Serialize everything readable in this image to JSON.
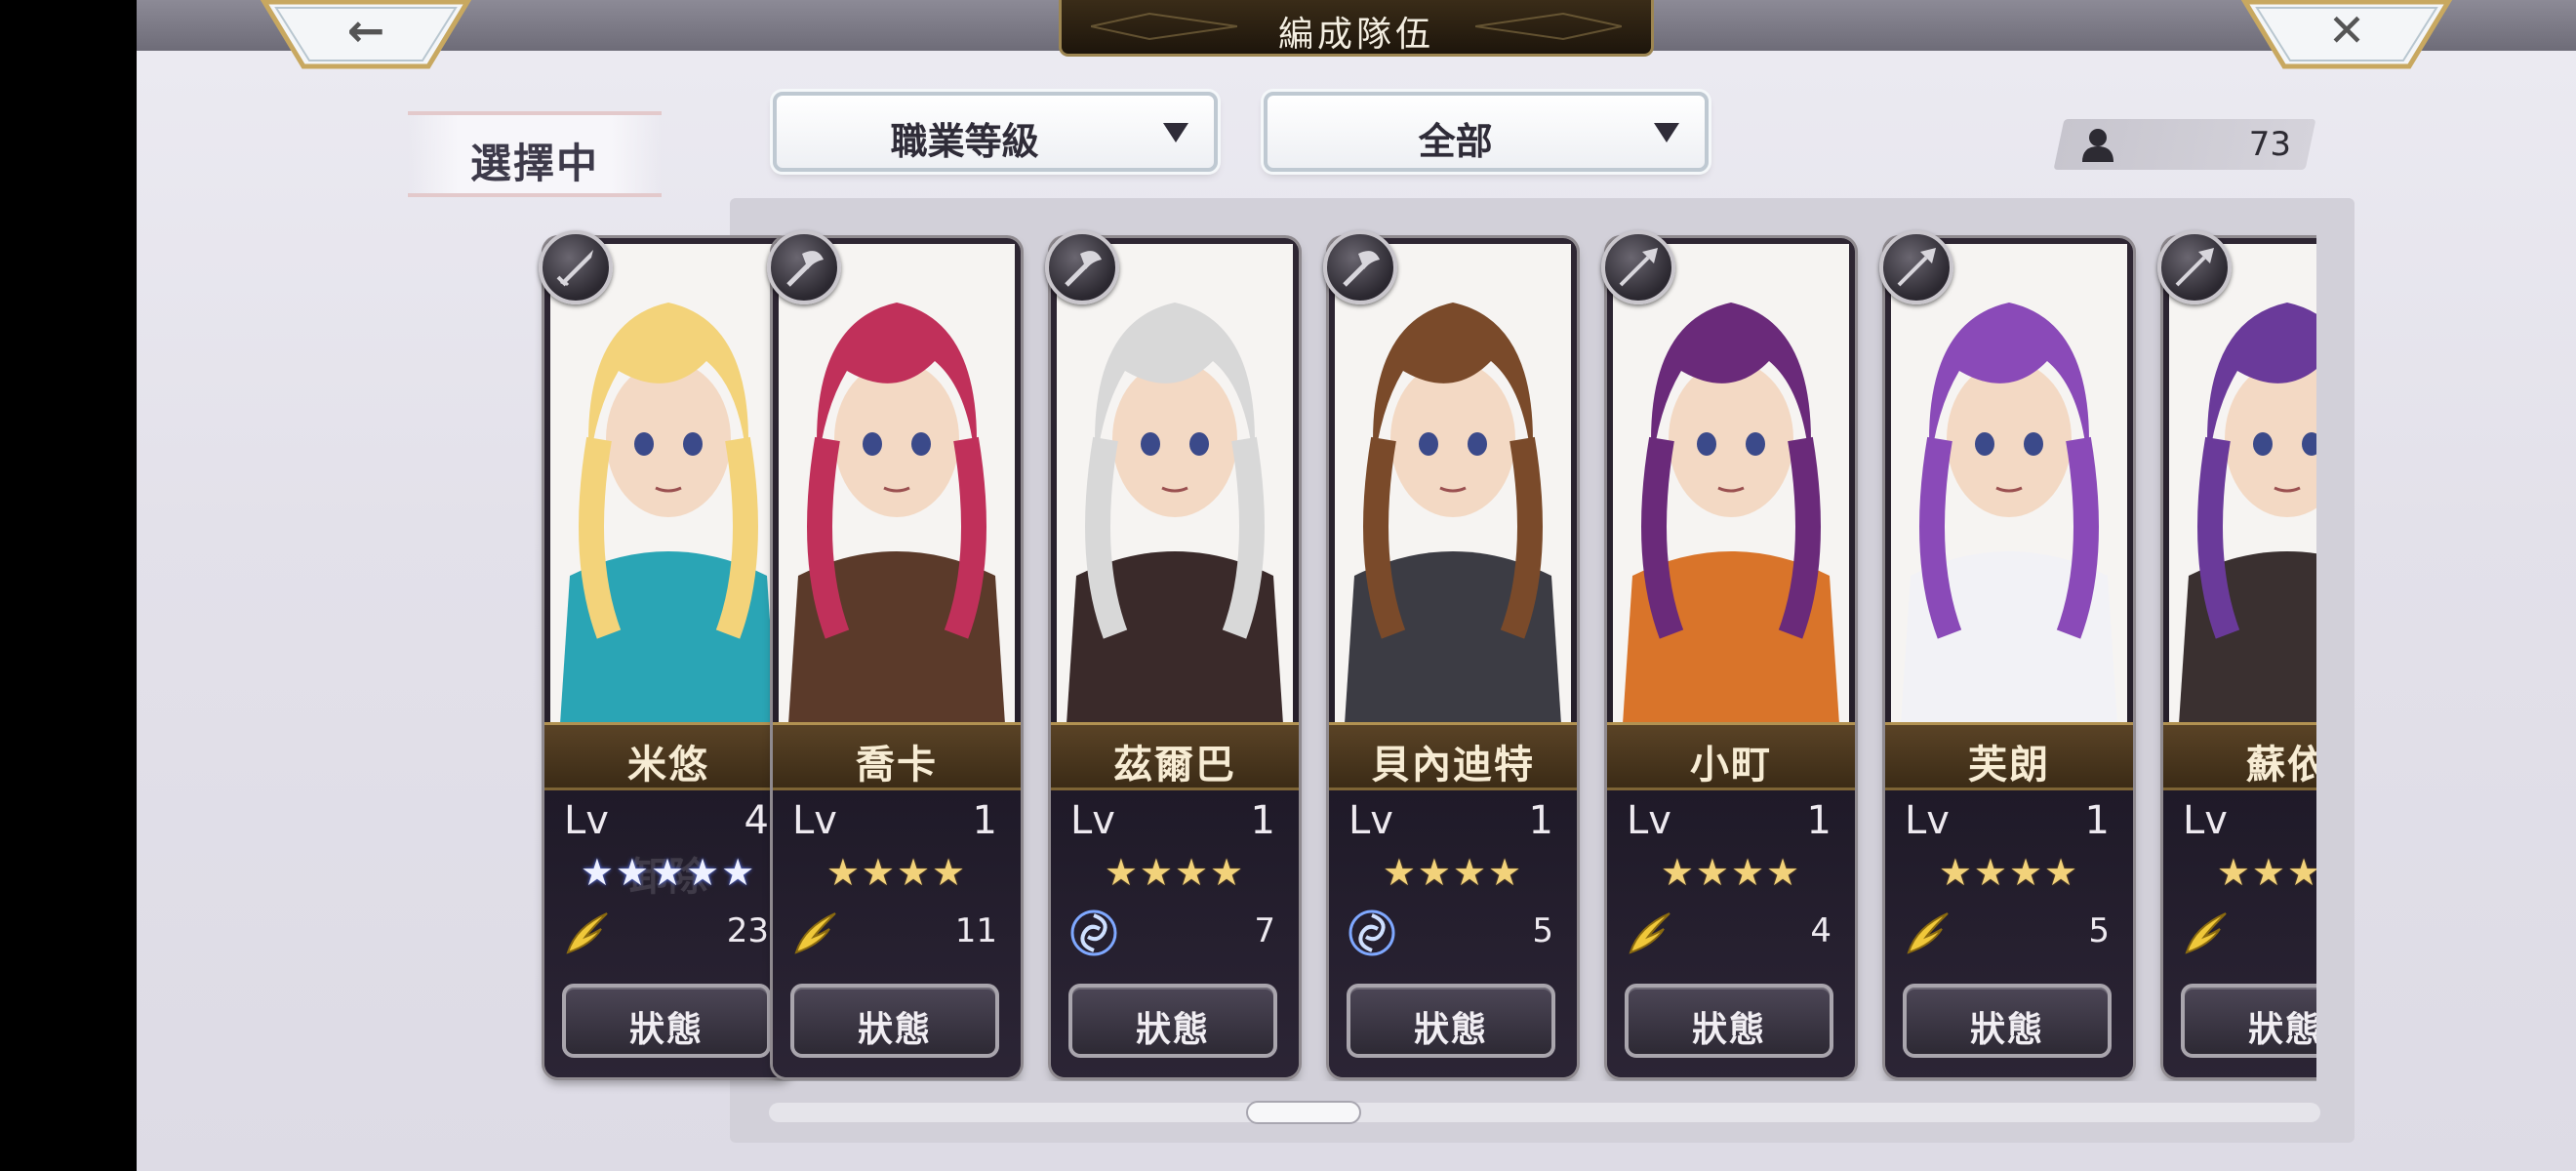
{
  "header": {
    "title": "編成隊伍",
    "back_glyph": "←",
    "close_glyph": "✕"
  },
  "selecting": {
    "label": "選擇中",
    "card": {
      "name": "米悠",
      "lv_label": "Lv",
      "level": "4",
      "stars": "★★★★★",
      "power": "23",
      "remove_label": "卸除",
      "status_label": "狀態",
      "class_icon": "sword-icon",
      "element_icon": "wind-icon",
      "hair_color": "#f3d37a",
      "outfit_color": "#2aa5b5"
    }
  },
  "filters": {
    "job_level": "職業等級",
    "scope": "全部"
  },
  "roster_count": "73",
  "roster": [
    {
      "name": "喬卡",
      "lv_label": "Lv",
      "level": "1",
      "stars": "★★★★",
      "power": "11",
      "status_label": "狀態",
      "class_icon": "axe-icon",
      "element_icon": "wind-icon",
      "hair_color": "#c0305a",
      "outfit_color": "#5b3a2a"
    },
    {
      "name": "茲爾巴",
      "lv_label": "Lv",
      "level": "1",
      "stars": "★★★★",
      "power": "7",
      "status_label": "狀態",
      "class_icon": "axe-icon",
      "element_icon": "vortex-icon",
      "hair_color": "#d8d8d8",
      "outfit_color": "#3a2a2a"
    },
    {
      "name": "貝內迪特",
      "lv_label": "Lv",
      "level": "1",
      "stars": "★★★★",
      "power": "5",
      "status_label": "狀態",
      "class_icon": "axe-icon",
      "element_icon": "vortex-icon",
      "hair_color": "#7a4a2a",
      "outfit_color": "#3c3c44"
    },
    {
      "name": "小町",
      "lv_label": "Lv",
      "level": "1",
      "stars": "★★★★",
      "power": "4",
      "status_label": "狀態",
      "class_icon": "spear-icon",
      "element_icon": "wind-icon",
      "hair_color": "#6a2a7a",
      "outfit_color": "#d9742a"
    },
    {
      "name": "芙朗",
      "lv_label": "Lv",
      "level": "1",
      "stars": "★★★★",
      "power": "5",
      "status_label": "狀態",
      "class_icon": "spear-icon",
      "element_icon": "wind-icon",
      "hair_color": "#8a4ab8",
      "outfit_color": "#f2f2f6"
    },
    {
      "name": "蘇依",
      "lv_label": "Lv",
      "level": "",
      "stars": "★★★★",
      "power": "",
      "status_label": "狀態",
      "class_icon": "spear-icon",
      "element_icon": "wind-icon",
      "hair_color": "#6a3a9a",
      "outfit_color": "#3a3030"
    }
  ],
  "colors": {
    "gold_star": "#f2d27a",
    "blue_star": "#eef1ff",
    "nameplate": "#5a4326",
    "card_bg": "#2e2633"
  }
}
